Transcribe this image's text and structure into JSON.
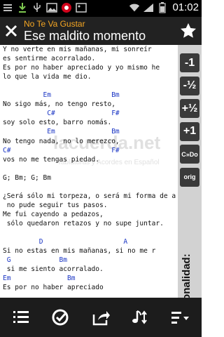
{
  "status_bar": {
    "time": "01:02"
  },
  "header": {
    "artist": "No Te Va Gustar",
    "title": "Ese maldito momento"
  },
  "watermark": {
    "main": "lacuerda.net",
    "sub": "Tablaturas y Acordes en Español"
  },
  "lyrics": [
    {
      "text": "Y no verte en mis mañanas, mi sonreír",
      "type": "lyric"
    },
    {
      "text": "es sentirme acorralado.",
      "type": "lyric"
    },
    {
      "text": "Es por no haber apreciado y yo mismo he",
      "type": "lyric"
    },
    {
      "text": "lo que la vida me dio.",
      "type": "lyric"
    },
    {
      "text": "",
      "type": "blank"
    },
    {
      "text": "          Em               Bm",
      "type": "chord"
    },
    {
      "text": "No sigo más, no tengo resto,",
      "type": "lyric"
    },
    {
      "text": "           C#              F#",
      "type": "chord"
    },
    {
      "text": "soy solo esto, barro nomás.",
      "type": "lyric"
    },
    {
      "text": "           Em              Bm",
      "type": "chord"
    },
    {
      "text": "No tengo nada, no lo merezco,",
      "type": "lyric"
    },
    {
      "text": "C#                         F#",
      "type": "chord"
    },
    {
      "text": "vos no me tengas piedad.",
      "type": "lyric"
    },
    {
      "text": "",
      "type": "blank"
    },
    {
      "text": "G; Bm; G; Bm",
      "type": "lyric"
    },
    {
      "text": "",
      "type": "blank"
    },
    {
      "text": "¿Será sólo mi torpeza, o será mi forma de a",
      "type": "lyric"
    },
    {
      "text": " no pude seguir tus pasos.",
      "type": "lyric"
    },
    {
      "text": "Me fui cayendo a pedazos,",
      "type": "lyric"
    },
    {
      "text": " sólo quedaron retazos y no supe juntar.",
      "type": "lyric"
    },
    {
      "text": "",
      "type": "blank"
    },
    {
      "text": "         D                    A",
      "type": "chord"
    },
    {
      "text": "Si no estas en mis mañanas, si no me r",
      "type": "lyric"
    },
    {
      "text": " G            Bm",
      "type": "chord"
    },
    {
      "text": " si me siento acorralado.",
      "type": "lyric"
    },
    {
      "text": "Em              Bm",
      "type": "chord"
    },
    {
      "text": "Es por no haber apreciado",
      "type": "lyric"
    }
  ],
  "transpose": {
    "buttons": [
      "-1",
      "-½",
      "+½",
      "+1",
      "C»Do",
      "orig"
    ],
    "label": "Tonalidad:"
  }
}
